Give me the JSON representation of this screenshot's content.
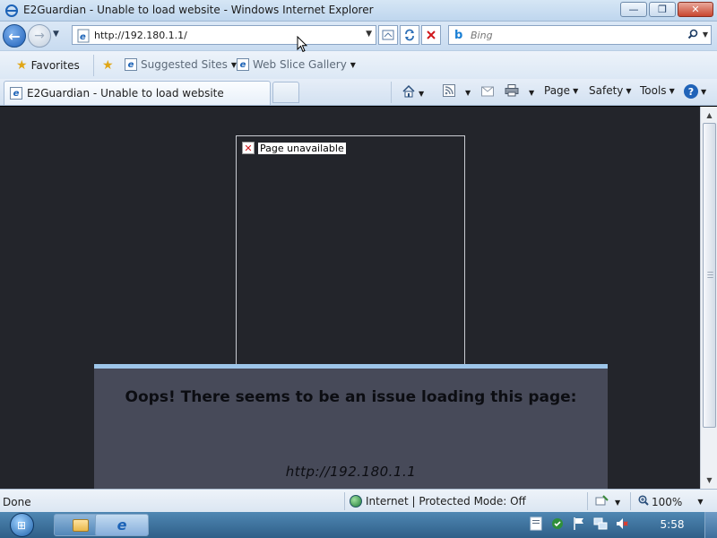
{
  "window": {
    "title": "E2Guardian - Unable to load website - Windows Internet Explorer",
    "buttons": {
      "minimize": "—",
      "maximize": "❐",
      "close": "✕"
    }
  },
  "nav": {
    "back_icon": "←",
    "forward_icon": "→",
    "address": "http://192.180.1.1/",
    "search_placeholder": "Bing"
  },
  "favorites": {
    "favorites_label": "Favorites",
    "items": [
      "Suggested Sites",
      "Web Slice Gallery"
    ]
  },
  "tab": {
    "title": "E2Guardian - Unable to load website"
  },
  "commandbar": {
    "page": "Page",
    "safety": "Safety",
    "tools": "Tools",
    "help_icon": "?"
  },
  "content": {
    "broken_image_alt": "Page unavailable",
    "heading": "Oops! There seems to be an issue loading this page:",
    "url": "http://192.180.1.1"
  },
  "status": {
    "text": "Done",
    "zone": "Internet | Protected Mode: Off",
    "zoom": "100%"
  },
  "taskbar": {
    "clock": "5:58"
  },
  "colors": {
    "content_bg": "#23252b",
    "panel_bg": "#474a59",
    "panel_accent": "#9ec6ea",
    "error_red": "#d0181c"
  }
}
